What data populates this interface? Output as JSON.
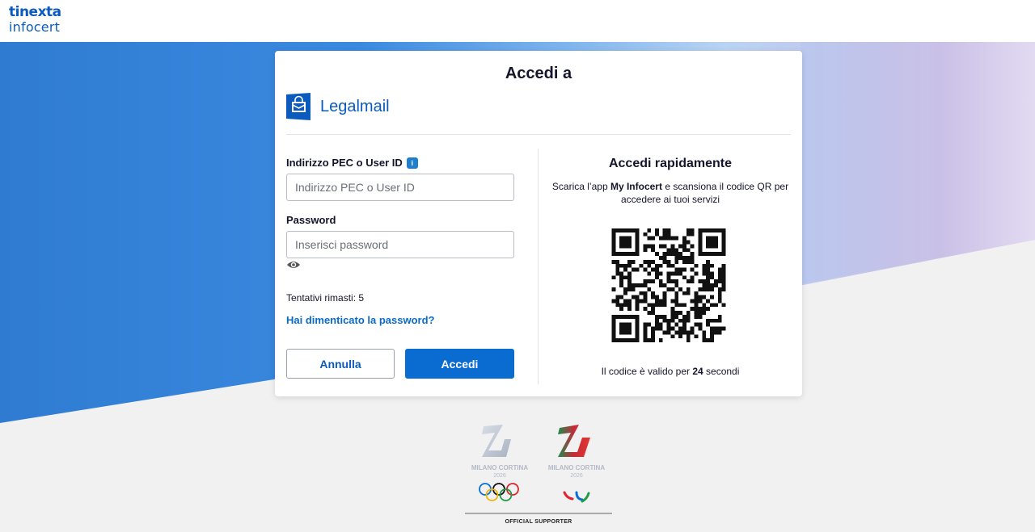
{
  "header": {
    "logo_line1": "tinexta",
    "logo_line2": "infocert"
  },
  "card": {
    "title": "Accedi a",
    "brand_name": "Legalmail",
    "brand_icon": "mail-box-icon"
  },
  "login": {
    "user_label": "Indirizzo PEC o User ID",
    "user_placeholder": "Indirizzo PEC o User ID",
    "user_value": "",
    "password_label": "Password",
    "password_placeholder": "Inserisci password",
    "password_value": "",
    "attempts_text": "Tentativi rimasti: 5",
    "forgot_link": "Hai dimenticato la password?",
    "cancel_button": "Annulla",
    "login_button": "Accedi"
  },
  "quick": {
    "title": "Accedi rapidamente",
    "desc_prefix": "Scarica l’app ",
    "desc_app": "My Infocert",
    "desc_suffix": " e scansiona il codice QR per accedere ai tuoi servizi",
    "validity_prefix": "Il codice è valido per ",
    "validity_seconds": "24",
    "validity_suffix": " secondi"
  },
  "footer": {
    "games_text_1": "MILANO CORTINA",
    "games_year_1": "2026",
    "games_text_2": "MILANO CORTINA",
    "games_year_2": "2026",
    "supporter_text": "OFFICIAL SUPPORTER"
  },
  "colors": {
    "accent": "#0a6bd1",
    "brand": "#0a5bbd",
    "background_blue": "#2f7fd6",
    "background_lilac": "#c9bfe6"
  }
}
